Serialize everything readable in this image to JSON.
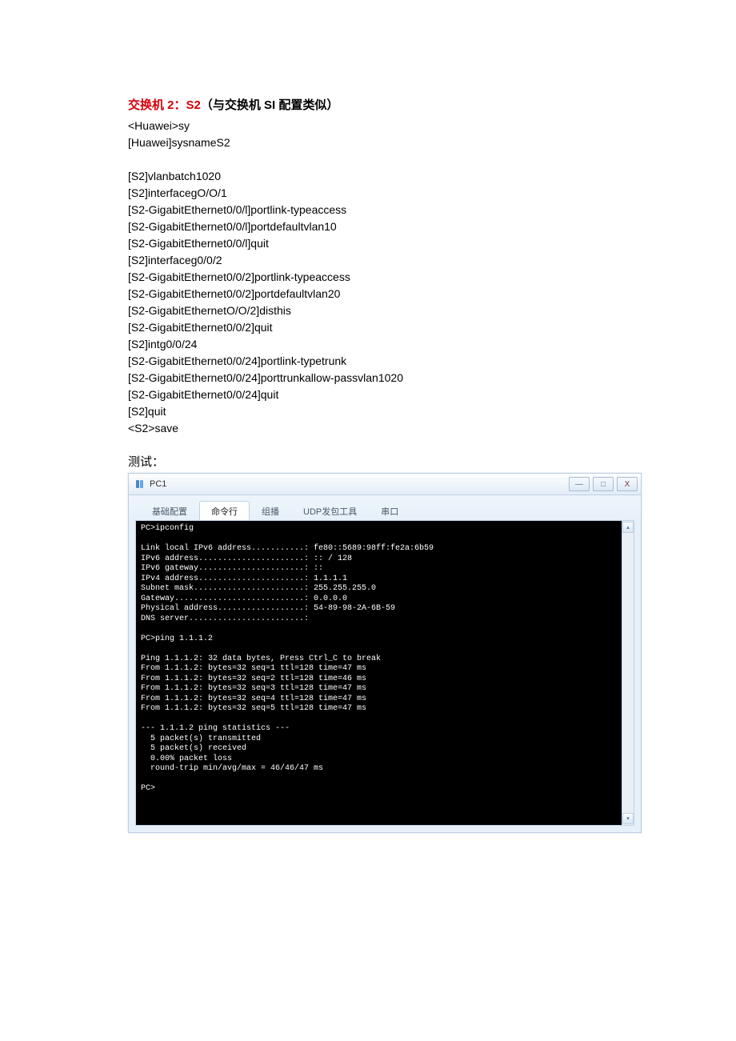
{
  "heading": {
    "red_prefix": "交换机 2：S2",
    "black_suffix": "（与交换机 SI 配置类似）"
  },
  "commands": [
    "<Huawei>sy",
    "[Huawei]sysnameS2",
    "",
    "[S2]vlanbatch1020",
    "[S2]interfacegO/O/1",
    "[S2-GigabitEthernet0/0/l]portlink-typeaccess",
    "[S2-GigabitEthernet0/0/l]portdefaultvlan10",
    "[S2-GigabitEthernet0/0/l]quit",
    "[S2]interfaceg0/0/2",
    "[S2-GigabitEthernet0/0/2]portlink-typeaccess",
    "[S2-GigabitEthernet0/0/2]portdefaultvlan20",
    "[S2-GigabitEthernetO/O/2]disthis",
    "[S2-GigabitEthernet0/0/2]quit",
    "[S2]intg0/0/24",
    "[S2-GigabitEthernet0/0/24]portlink-typetrunk",
    "[S2-GigabitEthernet0/0/24]porttrunkallow-passvlan1020",
    "[S2-GigabitEthernet0/0/24]quit",
    "[S2]quit",
    "<S2>save"
  ],
  "test_label": "测试：",
  "window": {
    "title": "PC1",
    "tabs": {
      "basic": "基础配置",
      "cmdline": "命令行",
      "multicast": "组播",
      "udp": "UDP发包工具",
      "serial": "串口"
    },
    "buttons": {
      "min": "—",
      "max": "□",
      "close": "X"
    }
  },
  "terminal_lines": [
    "PC>ipconfig",
    "",
    "Link local IPv6 address...........: fe80::5689:98ff:fe2a:6b59",
    "IPv6 address......................: :: / 128",
    "IPv6 gateway......................: ::",
    "IPv4 address......................: 1.1.1.1",
    "Subnet mask.......................: 255.255.255.0",
    "Gateway...........................: 0.0.0.0",
    "Physical address..................: 54-89-98-2A-6B-59",
    "DNS server........................:",
    "",
    "PC>ping 1.1.1.2",
    "",
    "Ping 1.1.1.2: 32 data bytes, Press Ctrl_C to break",
    "From 1.1.1.2: bytes=32 seq=1 ttl=128 time=47 ms",
    "From 1.1.1.2: bytes=32 seq=2 ttl=128 time=46 ms",
    "From 1.1.1.2: bytes=32 seq=3 ttl=128 time=47 ms",
    "From 1.1.1.2: bytes=32 seq=4 ttl=128 time=47 ms",
    "From 1.1.1.2: bytes=32 seq=5 ttl=128 time=47 ms",
    "",
    "--- 1.1.1.2 ping statistics ---",
    "  5 packet(s) transmitted",
    "  5 packet(s) received",
    "  0.00% packet loss",
    "  round-trip min/avg/max = 46/46/47 ms",
    "",
    "PC>"
  ]
}
